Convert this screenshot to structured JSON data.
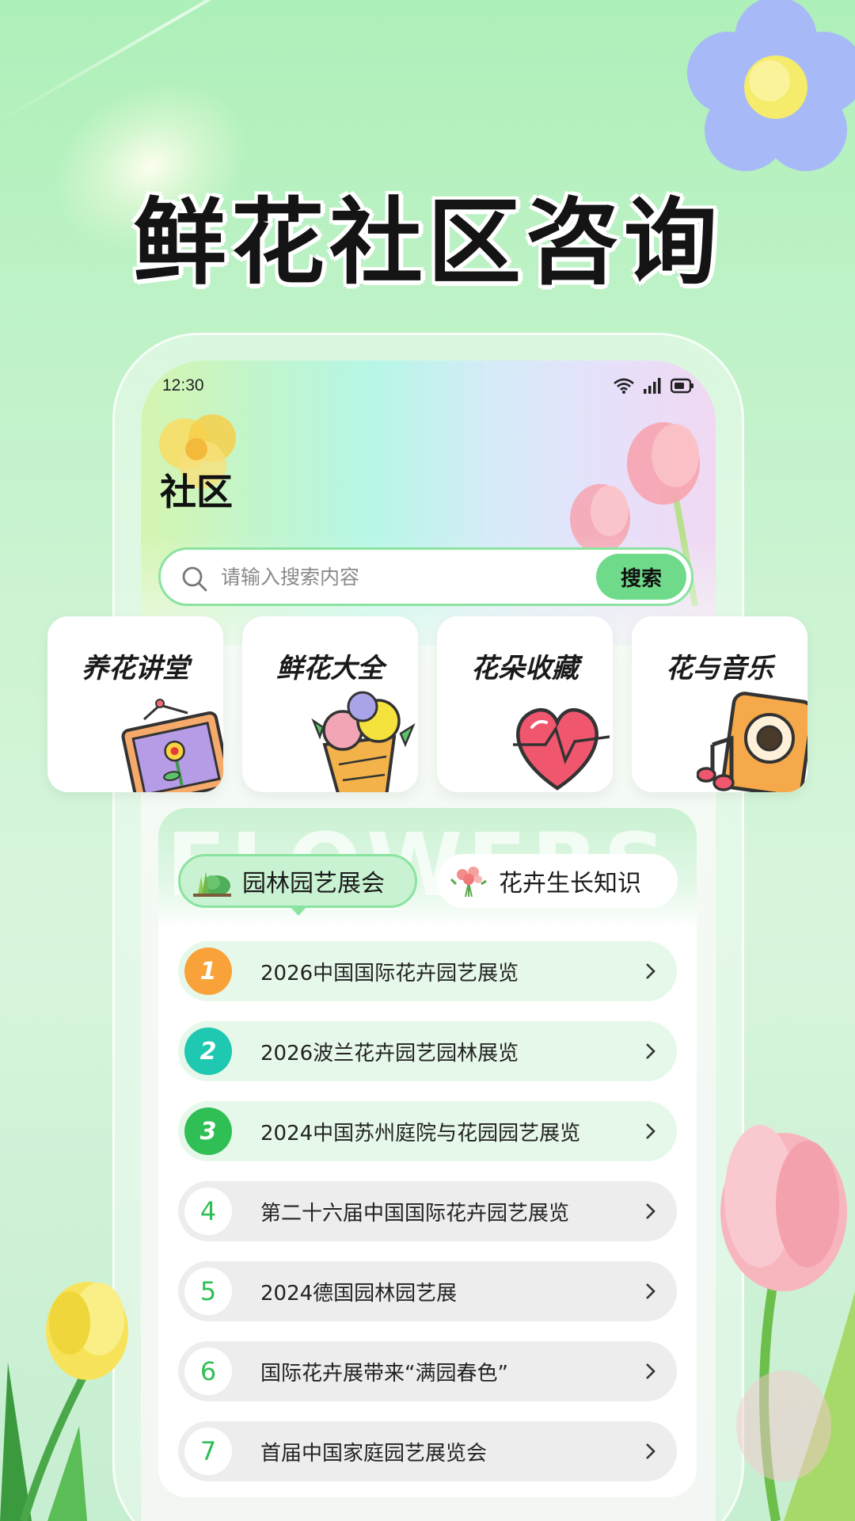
{
  "poster": {
    "title": "鲜花社区咨询"
  },
  "status_bar": {
    "time": "12:30"
  },
  "page": {
    "heading": "社区"
  },
  "search": {
    "placeholder": "请输入搜索内容",
    "button_label": "搜索"
  },
  "categories": [
    {
      "label": "养花讲堂",
      "icon": "picture-frame-flower-icon"
    },
    {
      "label": "鲜花大全",
      "icon": "flower-bouquet-icon"
    },
    {
      "label": "花朵收藏",
      "icon": "heart-icon"
    },
    {
      "label": "花与音乐",
      "icon": "music-speaker-icon"
    }
  ],
  "panel": {
    "watermark": "FLOWERS",
    "tabs": [
      {
        "label": "园林园艺展会",
        "icon": "garden-bush-icon",
        "active": true
      },
      {
        "label": "花卉生长知识",
        "icon": "flower-bouquet-icon",
        "active": false
      }
    ],
    "items": [
      {
        "rank": "1",
        "title": "2026中国国际花卉园艺展览",
        "color": "#f9a23a"
      },
      {
        "rank": "2",
        "title": "2026波兰花卉园艺园林展览",
        "color": "#1fc8b0"
      },
      {
        "rank": "3",
        "title": "2024中国苏州庭院与花园园艺展览",
        "color": "#2fbf55"
      },
      {
        "rank": "4",
        "title": "第二十六届中国国际花卉园艺展览"
      },
      {
        "rank": "5",
        "title": "2024德国园林园艺展"
      },
      {
        "rank": "6",
        "title": "国际花卉展带来“满园春色”"
      },
      {
        "rank": "7",
        "title": "首届中国家庭园艺展览会"
      }
    ]
  },
  "colors": {
    "accent": "#6fdb8a",
    "border": "#8be3a0"
  }
}
